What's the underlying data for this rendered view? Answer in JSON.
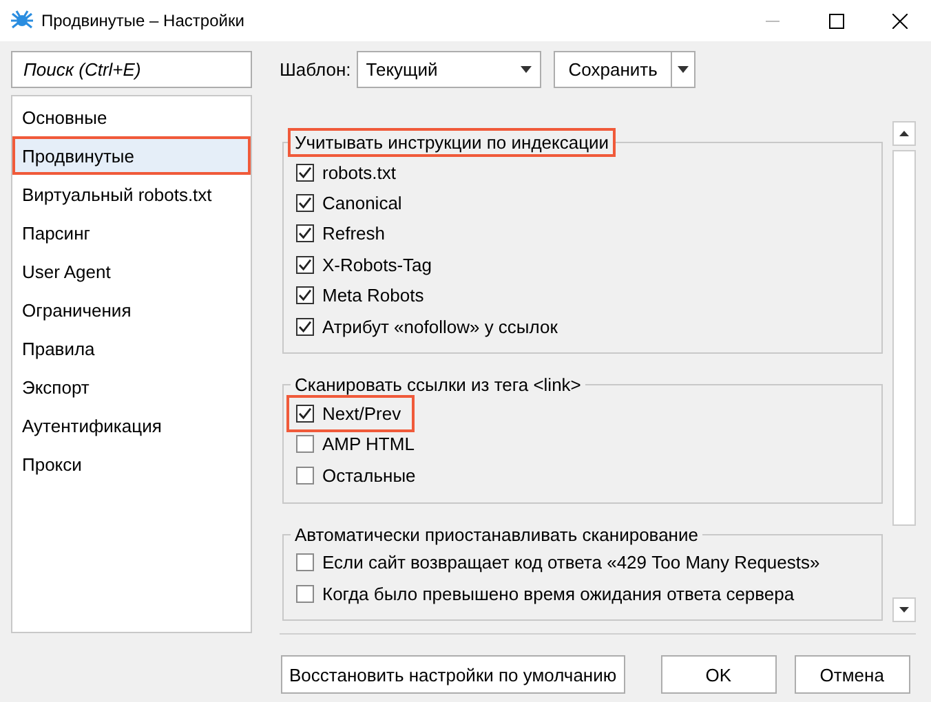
{
  "window": {
    "title": "Продвинутые – Настройки"
  },
  "search": {
    "placeholder": "Поиск (Ctrl+E)"
  },
  "sidebar": {
    "items": [
      {
        "label": "Основные",
        "selected": false,
        "highlighted": false
      },
      {
        "label": "Продвинутые",
        "selected": true,
        "highlighted": true
      },
      {
        "label": "Виртуальный robots.txt",
        "selected": false,
        "highlighted": false
      },
      {
        "label": "Парсинг",
        "selected": false,
        "highlighted": false
      },
      {
        "label": "User Agent",
        "selected": false,
        "highlighted": false
      },
      {
        "label": "Ограничения",
        "selected": false,
        "highlighted": false
      },
      {
        "label": "Правила",
        "selected": false,
        "highlighted": false
      },
      {
        "label": "Экспорт",
        "selected": false,
        "highlighted": false
      },
      {
        "label": "Аутентификация",
        "selected": false,
        "highlighted": false
      },
      {
        "label": "Прокси",
        "selected": false,
        "highlighted": false
      }
    ]
  },
  "template": {
    "label": "Шаблон:",
    "value": "Текущий"
  },
  "save_button": {
    "label": "Сохранить"
  },
  "groups": [
    {
      "title": "Учитывать инструкции по индексации",
      "highlighted": true,
      "options": [
        {
          "label": "robots.txt",
          "checked": true,
          "highlighted": false
        },
        {
          "label": "Canonical",
          "checked": true,
          "highlighted": false
        },
        {
          "label": "Refresh",
          "checked": true,
          "highlighted": false
        },
        {
          "label": "X-Robots-Tag",
          "checked": true,
          "highlighted": false
        },
        {
          "label": "Meta Robots",
          "checked": true,
          "highlighted": false
        },
        {
          "label": "Атрибут «nofollow» у ссылок",
          "checked": true,
          "highlighted": false
        }
      ]
    },
    {
      "title": "Сканировать ссылки из тега <link>",
      "highlighted": false,
      "options": [
        {
          "label": "Next/Prev",
          "checked": true,
          "highlighted": true
        },
        {
          "label": "AMP HTML",
          "checked": false,
          "highlighted": false
        },
        {
          "label": "Остальные",
          "checked": false,
          "highlighted": false
        }
      ]
    },
    {
      "title": "Автоматически приостанавливать сканирование",
      "highlighted": false,
      "options": [
        {
          "label": "Если сайт возвращает код ответа «429 Too Many Requests»",
          "checked": false,
          "highlighted": false
        },
        {
          "label": "Когда было превышено время ожидания ответа сервера",
          "checked": false,
          "highlighted": false
        }
      ]
    }
  ],
  "buttons": [
    {
      "label": "Восстановить настройки по умолчанию"
    },
    {
      "label": "OK"
    },
    {
      "label": "Отмена"
    }
  ]
}
